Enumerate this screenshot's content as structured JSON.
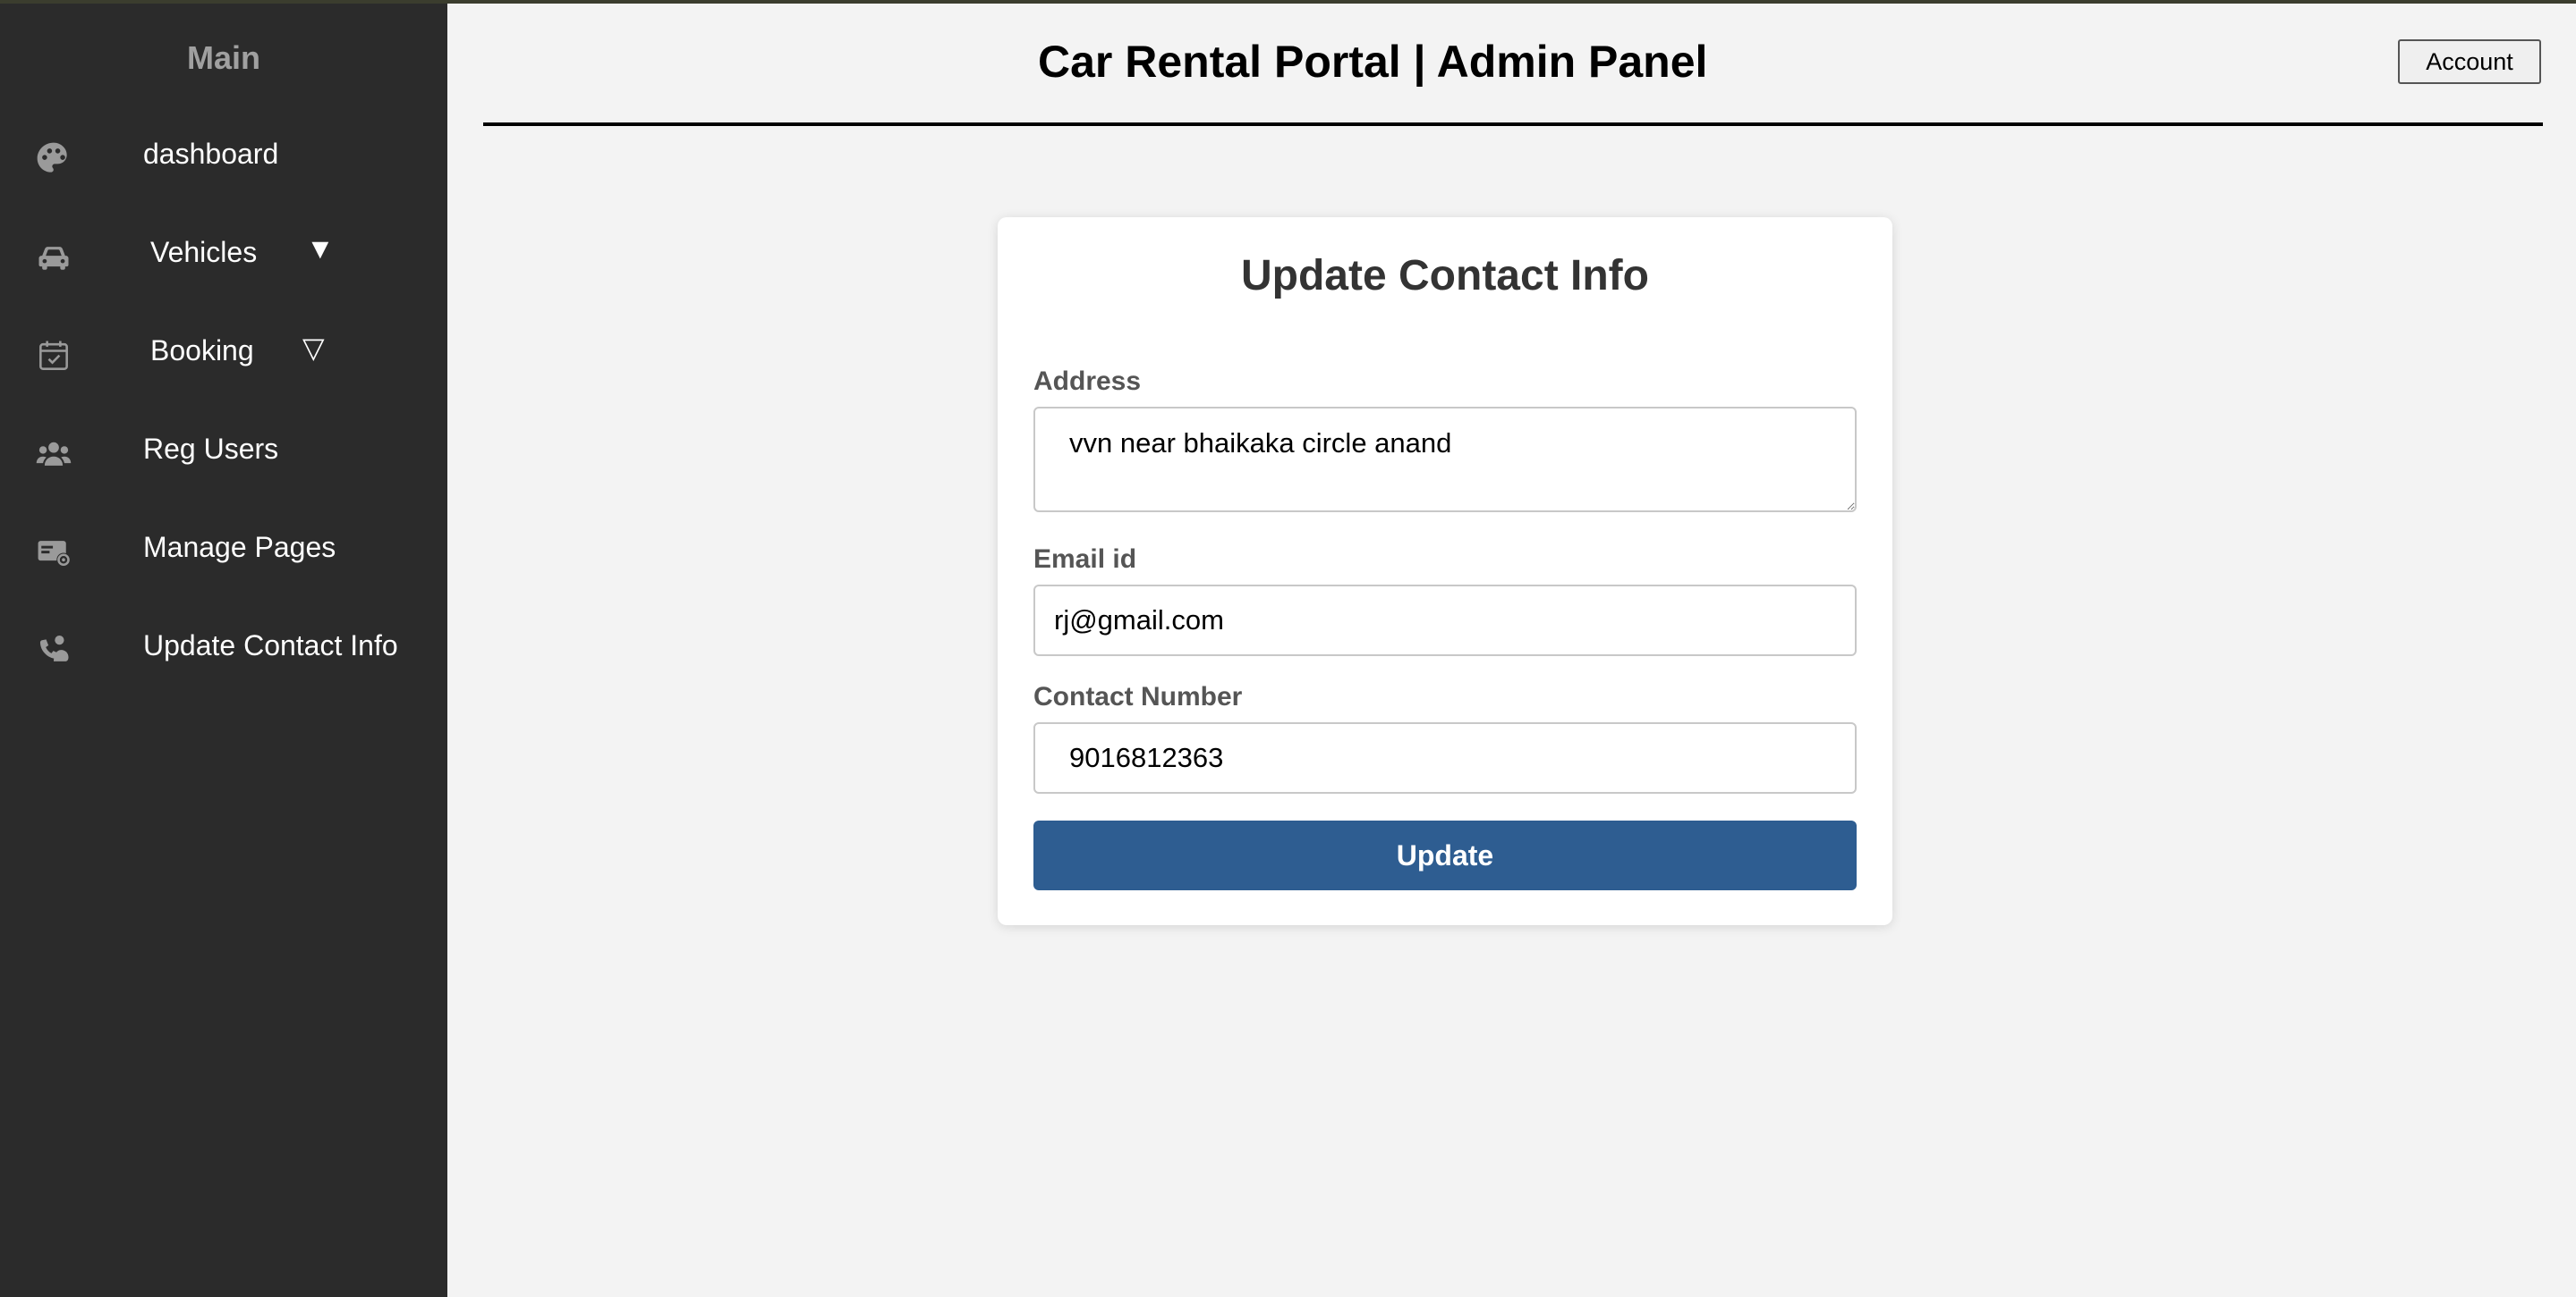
{
  "header": {
    "title": "Car Rental Portal | Admin Panel",
    "account_label": "Account"
  },
  "sidebar": {
    "title": "Main",
    "items": [
      {
        "label": "dashboard",
        "icon": "palette-icon"
      },
      {
        "label": "Vehicles",
        "icon": "car-icon",
        "arrow": "▼"
      },
      {
        "label": "Booking",
        "icon": "calendar-check-icon",
        "arrow": "▽"
      },
      {
        "label": "Reg Users",
        "icon": "users-icon"
      },
      {
        "label": "Manage Pages",
        "icon": "page-settings-icon"
      },
      {
        "label": "Update Contact Info",
        "icon": "phone-person-icon"
      }
    ]
  },
  "form": {
    "title": "Update Contact Info",
    "address_label": "Address",
    "address_value": "vvn near bhaikaka circle anand",
    "email_label": "Email id",
    "email_value": "rj@gmail.com",
    "contact_label": "Contact Number",
    "contact_value": "9016812363",
    "submit_label": "Update"
  },
  "colors": {
    "sidebar_bg": "#2b2b2b",
    "page_bg": "#f3f3f3",
    "button_bg": "#2e5d91"
  }
}
